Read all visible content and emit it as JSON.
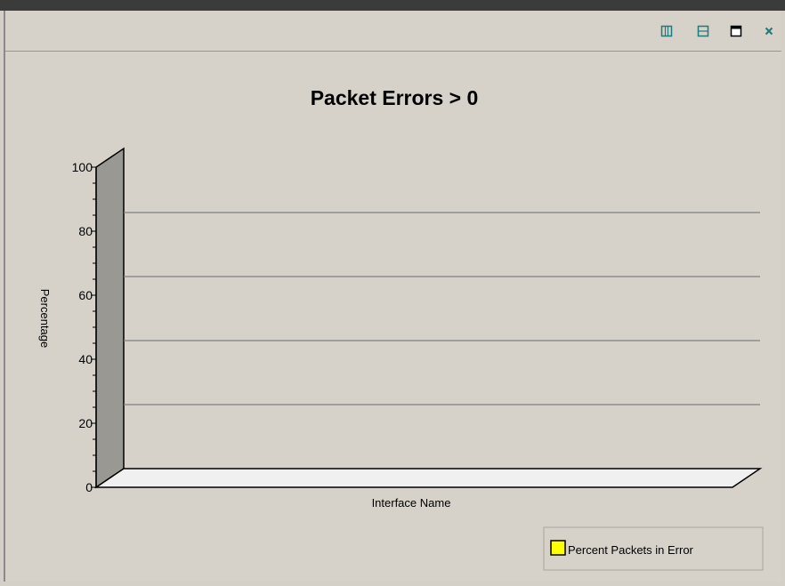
{
  "window": {
    "controls": [
      {
        "name": "split-vertical-icon",
        "icon": "split-vertical"
      },
      {
        "name": "split-horizontal-icon",
        "icon": "split-horizontal"
      },
      {
        "name": "maximize-icon",
        "icon": "maximize"
      },
      {
        "name": "close-icon",
        "icon": "close"
      }
    ]
  },
  "chart_data": {
    "type": "bar",
    "title": "Packet Errors > 0",
    "xlabel": "Interface Name",
    "ylabel": "Percentage",
    "categories": [],
    "series": [
      {
        "name": "Percent Packets in Error",
        "values": [],
        "color": "#ffff00"
      }
    ],
    "ylim": [
      0,
      100
    ],
    "yticks": [
      0,
      20,
      40,
      60,
      80,
      100
    ],
    "grid": true,
    "style": "3d",
    "legend": {
      "placement": "bottom-right",
      "label": "Percent Packets in Error"
    }
  },
  "colors": {
    "background": "#d6d2ca",
    "grid": "#808080",
    "wall": "#9a9893",
    "floor": "#f0f0f0",
    "accent_icon": "#1f7a7a"
  }
}
